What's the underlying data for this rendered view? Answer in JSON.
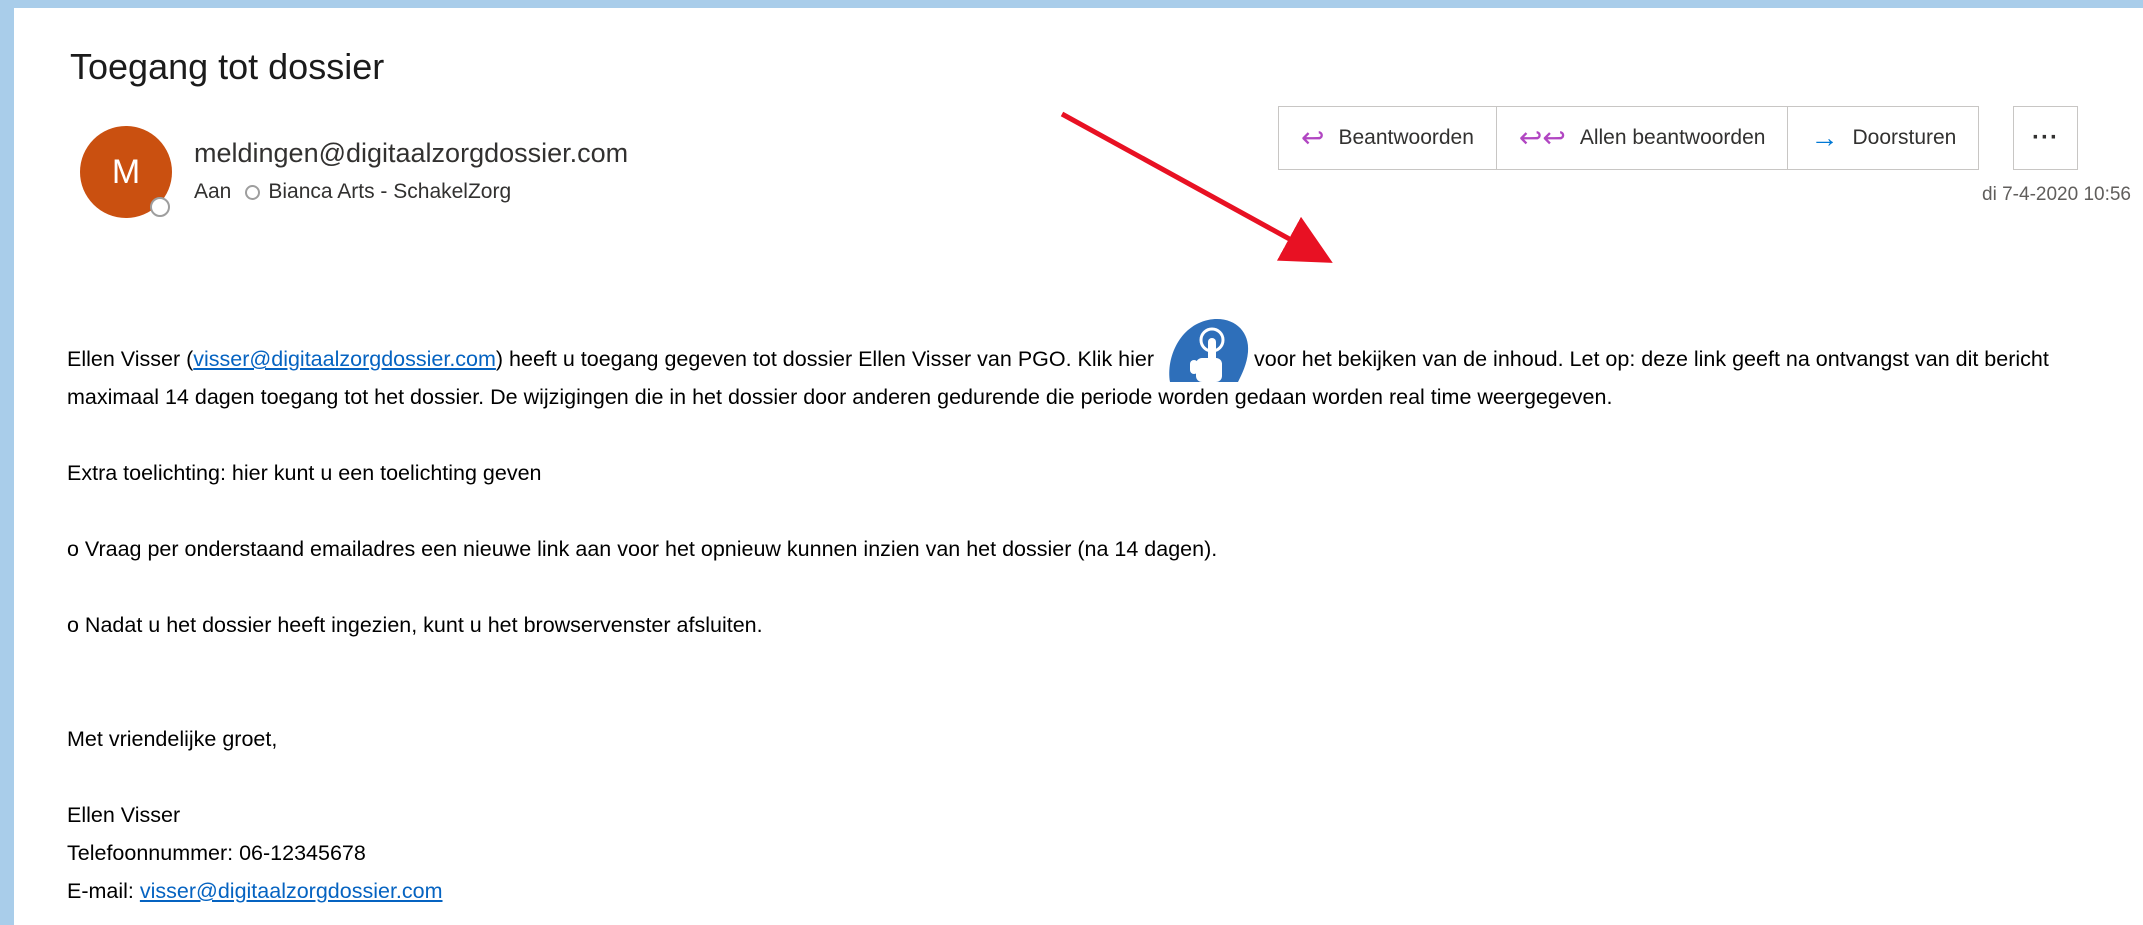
{
  "email": {
    "subject": "Toegang tot dossier",
    "avatar_initial": "M",
    "sender": "meldingen@digitaalzorgdossier.com",
    "to_label": "Aan",
    "recipient": "Bianca Arts - SchakelZorg",
    "date": "di 7-4-2020 10:56"
  },
  "actions": {
    "reply": {
      "label": "Beantwoorden",
      "icon": "reply-icon"
    },
    "reply_all": {
      "label": "Allen beantwoorden",
      "icon": "reply-all-icon"
    },
    "forward": {
      "label": "Doorsturen",
      "icon": "forward-arrow-icon"
    },
    "more": {
      "label": "···",
      "icon": "more-icon"
    }
  },
  "body": {
    "p1_name": "Ellen Visser (",
    "p1_link": "visser@digitaalzorgdossier.com",
    "p1_mid": ") heeft u toegang gegeven tot dossier Ellen Visser van PGO. Klik hier ",
    "p1_after": "voor het bekijken van de inhoud. Let op: deze link geeft na ontvangst van dit bericht maximaal 14 dagen toegang tot het dossier. De wijzigingen die in het dossier door anderen gedurende die periode worden gedaan worden real time weergegeven.",
    "p2": "Extra toelichting: hier kunt u een toelichting geven",
    "p3": "o Vraag per onderstaand emailadres een nieuwe link aan voor het opnieuw kunnen inzien van het dossier (na 14 dagen).",
    "p4": "o Nadat u het dossier heeft ingezien, kunt u het browservenster afsluiten.",
    "greeting": "Met vriendelijke groet,",
    "sig_name": "Ellen Visser",
    "sig_phone": "Telefoonnummer: 06-12345678",
    "sig_email_label": "E-mail: ",
    "sig_email": "visser@digitaalzorgdossier.com"
  },
  "colors": {
    "background": "#a9cdea",
    "avatar": "#ca5010",
    "link": "#0563c1",
    "arrow": "#e81123",
    "hand_icon": "#2e6fba"
  }
}
